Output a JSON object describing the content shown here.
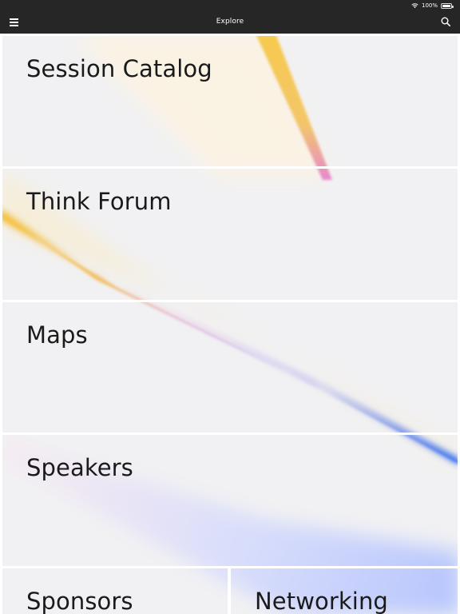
{
  "status_bar": {
    "battery_text": "100%"
  },
  "nav": {
    "title": "Explore",
    "menu_icon": "hamburger-menu-icon",
    "search_icon": "search-icon"
  },
  "tiles": [
    {
      "label": "Session Catalog"
    },
    {
      "label": "Think Forum"
    },
    {
      "label": "Maps"
    },
    {
      "label": "Speakers"
    },
    {
      "label": "Sponsors"
    },
    {
      "label": "Networking"
    }
  ],
  "colors": {
    "bar_background": "#262626",
    "tile_background": "#f1f1f3",
    "tile_text": "#1a1a1a",
    "streak_yellow": "#f7c948",
    "streak_pink": "#e6a2d0",
    "streak_purple": "#9b84ec",
    "streak_blue": "#2f6cf0"
  }
}
